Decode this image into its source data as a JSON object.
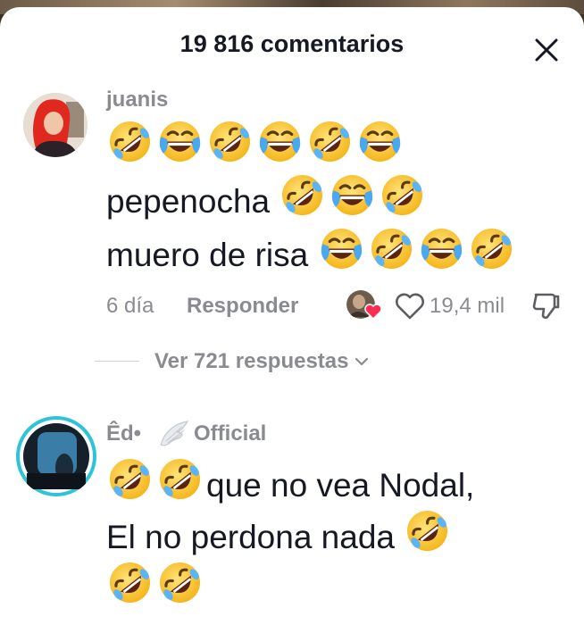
{
  "header": {
    "title": "19 816 comentarios"
  },
  "comments": [
    {
      "username": "juanis",
      "lines": [
        {
          "text": "",
          "emojis": [
            "rofl-emoji",
            "joy-emoji",
            "rofl-emoji",
            "joy-emoji",
            "rofl-emoji",
            "joy-emoji"
          ]
        },
        {
          "text": "pepenocha",
          "emojis": [
            "rofl-emoji",
            "joy-emoji",
            "rofl-emoji"
          ]
        },
        {
          "text": "muero de risa",
          "emojis": [
            "joy-emoji",
            "rofl-emoji",
            "joy-emoji",
            "rofl-emoji"
          ]
        }
      ],
      "time": "6 día",
      "reply_label": "Responder",
      "likes": "19,4 mil",
      "view_replies": "Ver 721 respuestas"
    },
    {
      "username": "Êd•",
      "badge": "Official",
      "lines": [
        {
          "text": "que no vea Nodal,",
          "emojis_before": [
            "rofl-emoji",
            "rofl-emoji"
          ]
        },
        {
          "text": "El no perdona nada",
          "emojis": [
            "rofl-emoji"
          ]
        },
        {
          "text": "",
          "emojis": [
            "rofl-emoji",
            "rofl-emoji"
          ]
        }
      ]
    }
  ],
  "colors": {
    "primary_text": "#161823",
    "secondary_text": "#8a8b91",
    "story_ring": "#2ec4d6",
    "heart_red": "#fe2c55"
  },
  "icons": [
    "close-icon",
    "heart-outline-icon",
    "dislike-icon",
    "chevron-down-icon",
    "wing-icon"
  ]
}
